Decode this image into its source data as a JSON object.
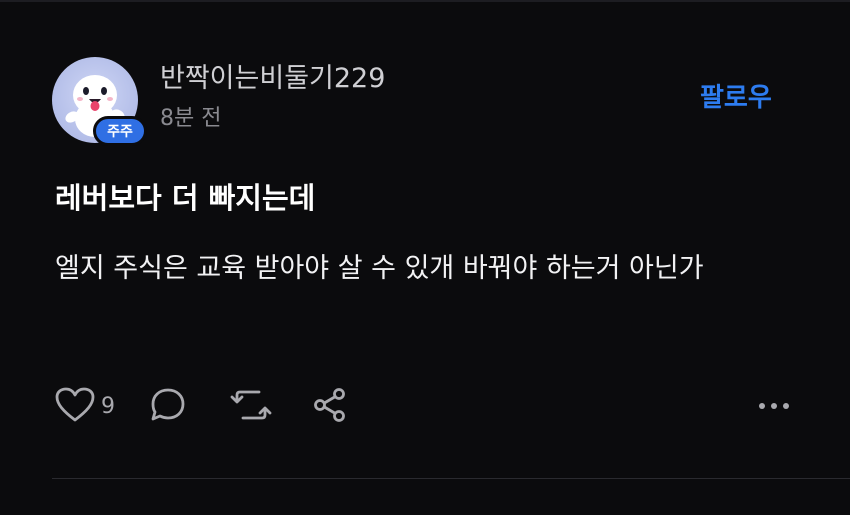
{
  "user": {
    "name": "반짝이는비둘기229",
    "badge": "주주",
    "time": "8분 전"
  },
  "follow_label": "팔로우",
  "post": {
    "title": "레버보다 더 빠지는데",
    "body": "엘지 주식은 교육 받아야 살 수 있개 바꿔야 하는거 아닌가"
  },
  "actions": {
    "like_count": "9",
    "icons": [
      "heart-icon",
      "comment-icon",
      "repost-icon",
      "share-icon",
      "more-icon"
    ]
  },
  "colors": {
    "background": "#0b0b0d",
    "accent": "#2d7cf0",
    "badge": "#2f6fe4",
    "muted": "#8a8a90"
  }
}
